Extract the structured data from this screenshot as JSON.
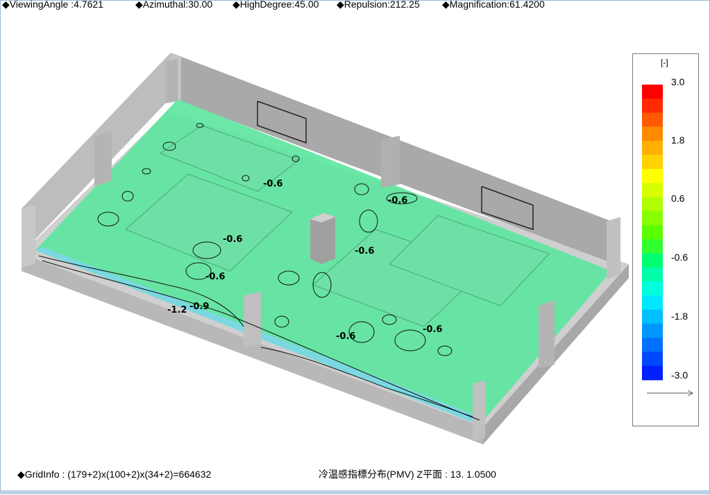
{
  "topbar": {
    "viewing_angle": "◆ViewingAngle :4.7621",
    "azimuthal": "◆Azimuthal:30.00",
    "high_degree": "◆HighDegree:45.00",
    "repulsion": "◆Repulsion:212.25",
    "magnification": "◆Magnification:61.4200"
  },
  "legend": {
    "unit": "[-]",
    "labels": [
      "3.0",
      "1.8",
      "0.6",
      "-0.6",
      "-1.8",
      "-3.0"
    ],
    "colors": [
      "#ff0000",
      "#ff2a00",
      "#ff5a00",
      "#ff8a00",
      "#ffb000",
      "#ffd200",
      "#ffff00",
      "#d8ff00",
      "#b0ff00",
      "#88ff00",
      "#5cff00",
      "#30ff30",
      "#00ff70",
      "#00ffaa",
      "#00ffdd",
      "#00e8ff",
      "#00c0ff",
      "#0098ff",
      "#0070ff",
      "#0048ff",
      "#0020ff"
    ]
  },
  "contours": [
    "-0.6",
    "-0.6",
    "-0.6",
    "-0.6",
    "-0.6",
    "-0.6",
    "-0.6",
    "-0.9",
    "-1.2"
  ],
  "status": {
    "grid_info": "◆GridInfo : (179+2)x(100+2)x(34+2)=664632",
    "plane_info": "冷温感指標分布(PMV) Z平面 : 13.  1.0500"
  }
}
